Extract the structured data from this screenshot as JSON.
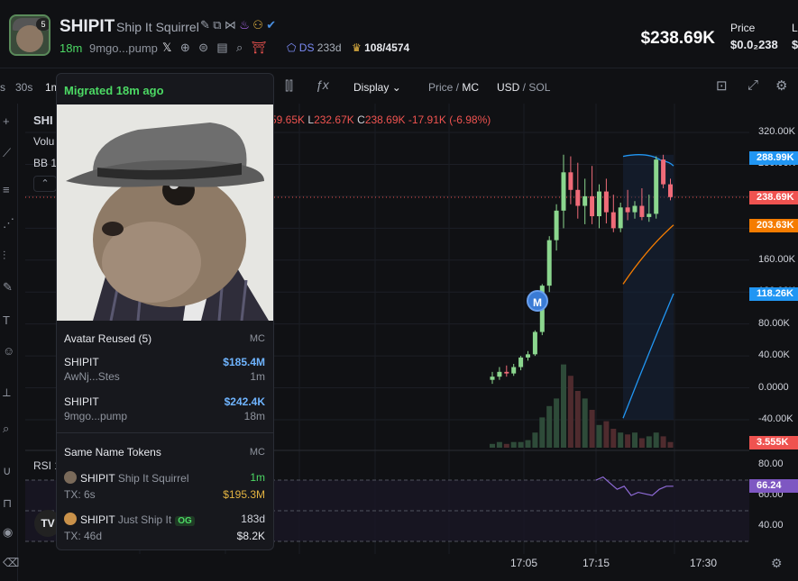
{
  "header": {
    "ticker": "SHIPIT",
    "name": "Ship It Squirrel",
    "avatar_badge": "5",
    "age": "18m",
    "address": "9mgo...pump",
    "ds_label": "DS",
    "ds_value": "233d",
    "holders": "108/4574",
    "big_price": "$238.69K",
    "price_label": "Price",
    "price_value": "$0.0₂238",
    "extra_label": "L",
    "extra_value": "$"
  },
  "toolbar": {
    "interval_s": "s",
    "interval_30s": "30s",
    "interval_1m": "1m",
    "display": "Display",
    "price_mc_a": "Price",
    "price_mc_b": "MC",
    "usd_sol_a": "USD",
    "usd_sol_b": "SOL"
  },
  "chart_overlay": {
    "left_title": "SHI",
    "volume": "Volu",
    "bb": "BB 1",
    "ohlc_h": "59.65K",
    "ohlc_l_key": "L",
    "ohlc_l": "232.67K",
    "ohlc_c_key": "C",
    "ohlc_c": "238.69K",
    "ohlc_change": "-17.91K (-6.98%)",
    "rsi_label": "RSI 1",
    "marker": "M"
  },
  "popup": {
    "migrated": "Migrated 18m ago",
    "avatar_reused_title": "Avatar Reused (5)",
    "mc_header_1": "MC",
    "avatar_rows": [
      {
        "name": "SHIPIT",
        "sub": "AwNj...Stes",
        "value": "$185.4M",
        "time": "1m"
      },
      {
        "name": "SHIPIT",
        "sub": "9mgo...pump",
        "value": "$242.4K",
        "time": "18m"
      }
    ],
    "same_name_title": "Same Name Tokens",
    "mc_header_2": "MC",
    "same_rows": [
      {
        "name": "SHIPIT",
        "full": "Ship It Squirrel",
        "time": "1m",
        "tx": "TX: 6s",
        "mc": "$195.3M"
      },
      {
        "name": "SHIPIT",
        "full": "Just Ship It",
        "badge": "OG",
        "time": "183d",
        "tx": "TX: 46d",
        "mc": "$8.2K"
      }
    ]
  },
  "chart_data": {
    "type": "candlestick",
    "price_axis_labels": [
      "320.00K",
      "280.00K",
      "240.00K",
      "200.00K",
      "160.00K",
      "120.00K",
      "80.00K",
      "40.00K",
      "0.0000",
      "-40.00K"
    ],
    "price_tags": [
      {
        "label": "288.99K",
        "color": "#2196f3"
      },
      {
        "label": "238.69K",
        "color": "#ef5350"
      },
      {
        "label": "203.63K",
        "color": "#f57c00"
      },
      {
        "label": "118.26K",
        "color": "#2196f3"
      },
      {
        "label": "3.555K",
        "color": "#ef5350"
      }
    ],
    "rsi_axis_labels": [
      "80.00",
      "60.00",
      "40.00"
    ],
    "rsi_tag": {
      "label": "66.24",
      "color": "#7e57c2"
    },
    "time_labels": [
      "17:05",
      "17:15",
      "17:30"
    ],
    "candles": [
      {
        "o": 10,
        "h": 20,
        "l": 5,
        "c": 14
      },
      {
        "o": 14,
        "h": 26,
        "l": 10,
        "c": 20
      },
      {
        "o": 20,
        "h": 28,
        "l": 14,
        "c": 18
      },
      {
        "o": 18,
        "h": 30,
        "l": 15,
        "c": 26
      },
      {
        "o": 26,
        "h": 40,
        "l": 22,
        "c": 38
      },
      {
        "o": 38,
        "h": 46,
        "l": 34,
        "c": 42
      },
      {
        "o": 42,
        "h": 72,
        "l": 40,
        "c": 70
      },
      {
        "o": 70,
        "h": 130,
        "l": 66,
        "c": 128
      },
      {
        "o": 128,
        "h": 190,
        "l": 120,
        "c": 185
      },
      {
        "o": 185,
        "h": 230,
        "l": 172,
        "c": 222
      },
      {
        "o": 222,
        "h": 292,
        "l": 200,
        "c": 270
      },
      {
        "o": 270,
        "h": 290,
        "l": 230,
        "c": 248
      },
      {
        "o": 248,
        "h": 282,
        "l": 212,
        "c": 228
      },
      {
        "o": 228,
        "h": 262,
        "l": 205,
        "c": 240
      },
      {
        "o": 240,
        "h": 278,
        "l": 205,
        "c": 215
      },
      {
        "o": 215,
        "h": 255,
        "l": 200,
        "c": 246
      },
      {
        "o": 246,
        "h": 262,
        "l": 206,
        "c": 220
      },
      {
        "o": 220,
        "h": 242,
        "l": 195,
        "c": 200
      },
      {
        "o": 200,
        "h": 232,
        "l": 195,
        "c": 226
      },
      {
        "o": 226,
        "h": 248,
        "l": 210,
        "c": 220
      },
      {
        "o": 220,
        "h": 234,
        "l": 212,
        "c": 228
      },
      {
        "o": 228,
        "h": 250,
        "l": 210,
        "c": 214
      },
      {
        "o": 214,
        "h": 242,
        "l": 208,
        "c": 218
      },
      {
        "o": 218,
        "h": 290,
        "l": 212,
        "c": 286
      },
      {
        "o": 286,
        "h": 292,
        "l": 250,
        "c": 255
      },
      {
        "o": 255,
        "h": 262,
        "l": 235,
        "c": 239
      }
    ],
    "volumes": [
      2,
      3,
      2,
      3,
      3,
      4,
      8,
      16,
      22,
      26,
      44,
      38,
      30,
      26,
      20,
      12,
      14,
      10,
      8,
      7,
      8,
      5,
      6,
      8,
      6,
      3
    ],
    "rsi": [
      70,
      72,
      68,
      64,
      66,
      60,
      62,
      61,
      60,
      64,
      66,
      66
    ]
  }
}
